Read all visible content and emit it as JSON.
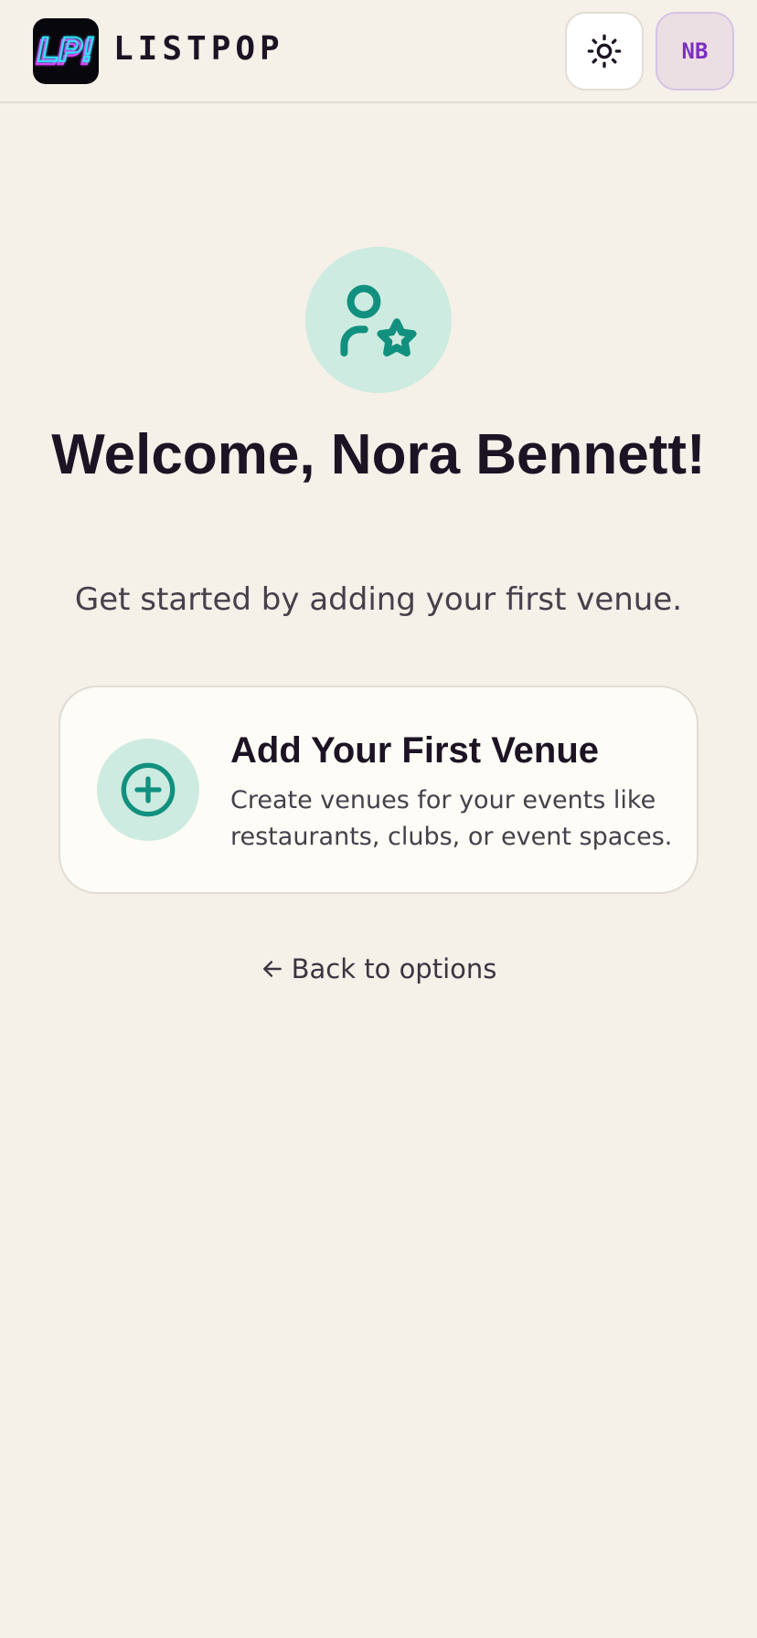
{
  "header": {
    "logo_text": "LP!",
    "brand_name": "LISTPOP",
    "theme_icon": "sun-icon",
    "avatar_initials": "NB"
  },
  "hero": {
    "icon": "user-star-icon",
    "welcome": "Welcome, Nora Bennett!",
    "subtitle": "Get started by adding your first venue."
  },
  "venue_card": {
    "icon": "plus-circle-icon",
    "title": "Add Your First Venue",
    "description": "Create venues for your events like restaurants, clubs, or event spaces."
  },
  "back_link": {
    "icon": "arrow-left-icon",
    "label": "Back to options"
  },
  "colors": {
    "background": "#f5f0e8",
    "accent_teal": "#12907f",
    "accent_teal_light": "#cdebe0",
    "avatar_purple": "#7b2fbf",
    "neon_cyan": "#33e6ff",
    "neon_magenta": "#e040fb"
  }
}
